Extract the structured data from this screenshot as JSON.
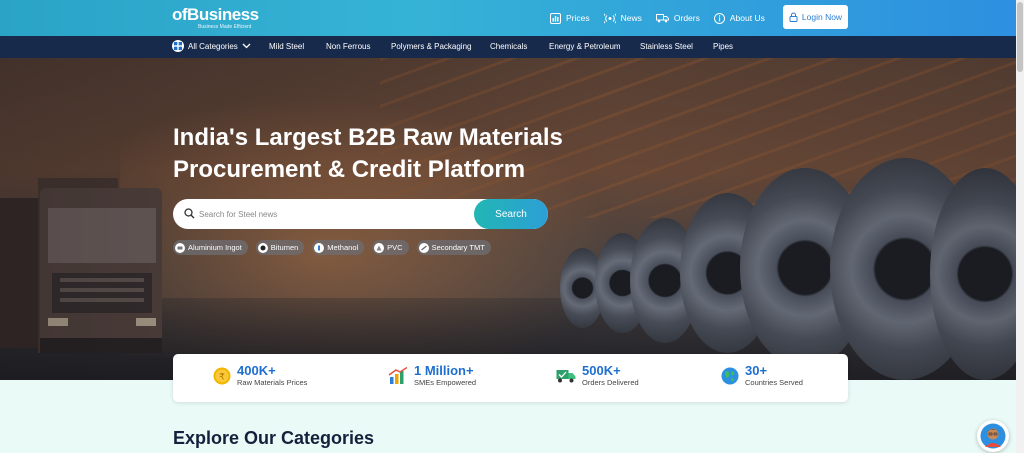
{
  "header": {
    "logo_text": "ofBusiness",
    "logo_tagline": "Business Made Efficient",
    "nav": [
      {
        "label": "Prices",
        "icon": "chart-icon"
      },
      {
        "label": "News",
        "icon": "broadcast-icon"
      },
      {
        "label": "Orders",
        "icon": "truck-icon"
      },
      {
        "label": "About Us",
        "icon": "info-icon"
      }
    ],
    "login_label": "Login Now"
  },
  "categories": {
    "all_label": "All Categories",
    "items": [
      "Mild Steel",
      "Non Ferrous",
      "Polymers & Packaging",
      "Chemicals",
      "Energy & Petroleum",
      "Stainless Steel",
      "Pipes"
    ]
  },
  "hero": {
    "headline_line1": "India's Largest B2B Raw Materials",
    "headline_line2": "Procurement & Credit Platform",
    "search_placeholder": "Search for Steel news",
    "search_button": "Search",
    "chips": [
      "Aluminium Ingot",
      "Bitumen",
      "Methanol",
      "PVC",
      "Secondary TMT"
    ]
  },
  "stats": [
    {
      "value": "400K+",
      "label": "Raw Materials Prices",
      "icon": "rupee-coin-icon"
    },
    {
      "value": "1 Million+",
      "label": "SMEs Empowered",
      "icon": "growth-chart-icon"
    },
    {
      "value": "500K+",
      "label": "Orders Delivered",
      "icon": "delivery-truck-icon"
    },
    {
      "value": "30+",
      "label": "Countries Served",
      "icon": "globe-icon"
    }
  ],
  "sections": {
    "explore_title": "Explore Our Categories"
  },
  "colors": {
    "header_gradient_start": "#2aa3c7",
    "header_gradient_end": "#2d8fe0",
    "category_bar": "#182a4c",
    "accent_blue": "#1f6fd0",
    "search_button": "#21b6b4"
  }
}
